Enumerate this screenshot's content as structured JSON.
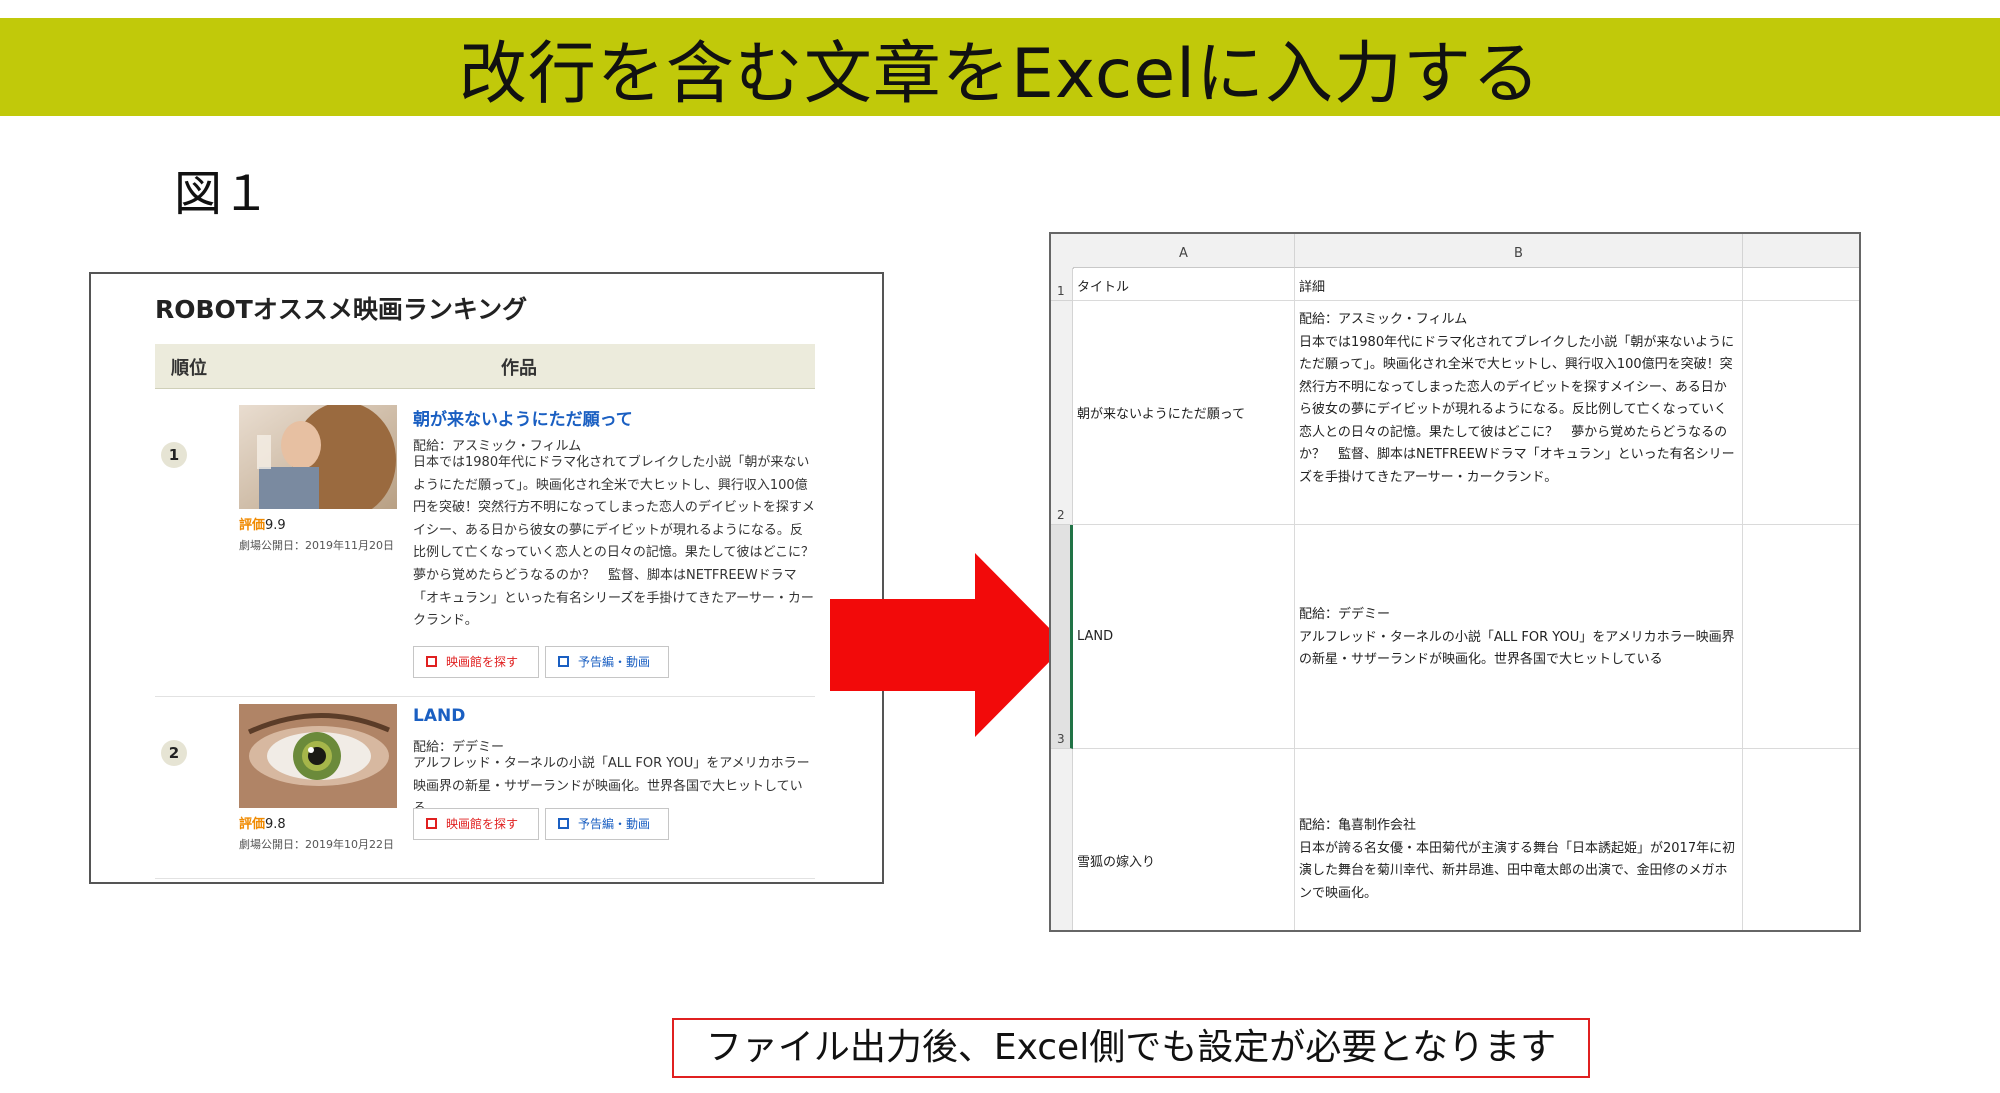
{
  "header": {
    "title": "改行を含む文章をExcelに入力する"
  },
  "figure_label": "図１",
  "web": {
    "title": "ROBOTオススメ映画ランキング",
    "col_rank": "順位",
    "col_work": "作品",
    "entries": [
      {
        "rank": "1",
        "title": "朝が来ないようにただ願って",
        "distributor": "配給：アスミック・フィルム",
        "desc": "日本では1980年代にドラマ化されてブレイクした小説「朝が来ないようにただ願って」。映画化され全米で大ヒットし、興行収入100億円を突破！突然行方不明になってしまった恋人のデイビットを探すメイシー、ある日から彼女の夢にデイビットが現れるようになる。反比例して亡くなっていく恋人との日々の記憶。果たして彼はどこに？夢から覚めたらどうなるのか？　監督、脚本はNETFREEWドラマ「オキュラン」といった有名シリーズを手掛けてきたアーサー・カークランド。",
        "rating_label": "評価",
        "rating": "9.9",
        "release": "劇場公開日：2019年11月20日",
        "btn_theater": "映画館を探す",
        "btn_trailer": "予告編・動画"
      },
      {
        "rank": "2",
        "title": "LAND",
        "distributor": "配給：デデミー",
        "desc": "アルフレッド・ターネルの小説「ALL FOR YOU」をアメリカホラー映画界の新星・サザーランドが映画化。世界各国で大ヒットしている",
        "rating_label": "評価",
        "rating": "9.8",
        "release": "劇場公開日：2019年10月22日",
        "btn_theater": "映画館を探す",
        "btn_trailer": "予告編・動画"
      }
    ]
  },
  "excel": {
    "columns": [
      "A",
      "B"
    ],
    "rows": [
      {
        "num": "1",
        "a": "タイトル",
        "b": "詳細"
      },
      {
        "num": "2",
        "a": "朝が来ないようにただ願って",
        "b": "配給：アスミック・フィルム\n日本では1980年代にドラマ化されてブレイクした小説「朝が来ないようにただ願って」。映画化され全米で大ヒットし、興行収入100億円を突破！突然行方不明になってしまった恋人のデイビットを探すメイシー、ある日から彼女の夢にデイビットが現れるようになる。反比例して亡くなっていく恋人との日々の記憶。果たして彼はどこに？　夢から覚めたらどうなるのか？　監督、脚本はNETFREEWドラマ「オキュラン」といった有名シリーズを手掛けてきたアーサー・カークランド。"
      },
      {
        "num": "3",
        "a": "LAND",
        "b": "配給：デデミー\nアルフレッド・ターネルの小説「ALL FOR YOU」をアメリカホラー映画界の新星・サザーランドが映画化。世界各国で大ヒットしている"
      },
      {
        "num": "",
        "a": "雪狐の嫁入り",
        "b": "配給：亀喜制作会社\n日本が誇る名女優・本田菊代が主演する舞台「日本誘起姫」が2017年に初演した舞台を菊川幸代、新井昂進、田中竜太郎の出演で、金田修のメガホンで映画化。"
      }
    ]
  },
  "note": "ファイル出力後、Excel側でも設定が必要となります",
  "colors": {
    "banner": "#c1c90a",
    "arrow": "#f20a0a",
    "link": "#1a5fc2",
    "rating": "#f08a00",
    "note_border": "#e02020"
  }
}
